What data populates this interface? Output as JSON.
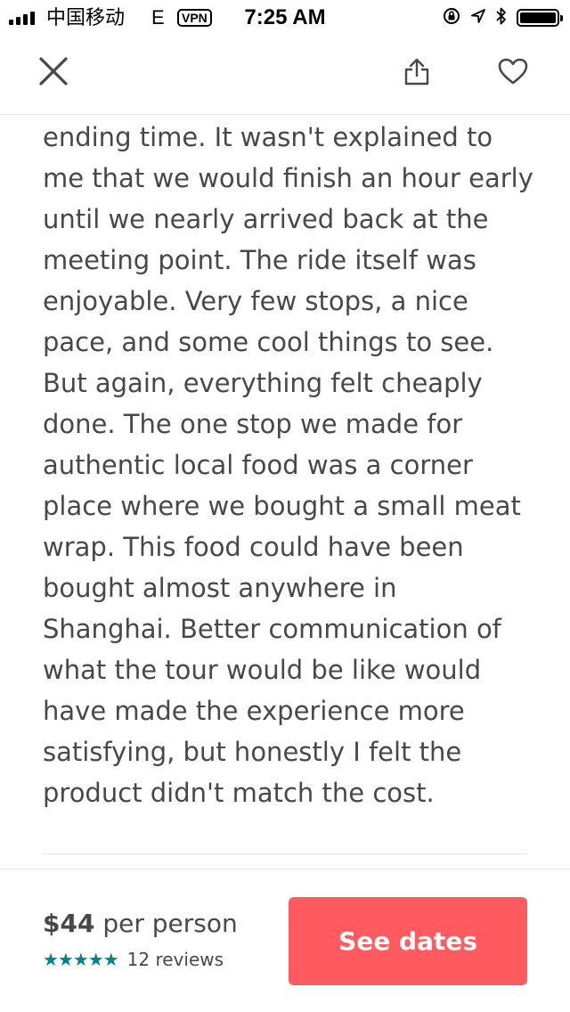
{
  "status_bar": {
    "carrier": "中国移动",
    "network": "E",
    "vpn": "VPN",
    "time": "7:25 AM"
  },
  "icons": {
    "close": "close-icon",
    "share": "share-icon",
    "favorite": "heart-icon",
    "signal": "signal-strength-icon",
    "orientation_lock": "orientation-lock-icon",
    "location": "location-arrow-icon",
    "bluetooth": "bluetooth-icon",
    "battery": "battery-icon"
  },
  "review": {
    "text": "ending time. It wasn't explained to\nme that we would finish an hour early\nuntil we nearly arrived back at the\nmeeting point. The ride itself was\nenjoyable. Very few stops, a nice\npace,  and some cool things to see.\nBut again, everything felt cheaply\ndone. The one stop we made for\nauthentic local food was a corner\nplace where we bought a small meat\nwrap. This food could have been\nbought almost anywhere in\nShanghai. Better communication of\nwhat the tour would be like would\nhave made the experience more\nsatisfying, but honestly I felt the\nproduct didn't match the cost."
  },
  "footer": {
    "price": "$44",
    "price_unit": "per person",
    "rating_stars": "★★★★★",
    "rating_value": 5,
    "reviews_label": "12 reviews",
    "cta_label": "See dates"
  },
  "colors": {
    "accent": "#ff5a5f",
    "star": "#008489",
    "text": "#484848"
  }
}
